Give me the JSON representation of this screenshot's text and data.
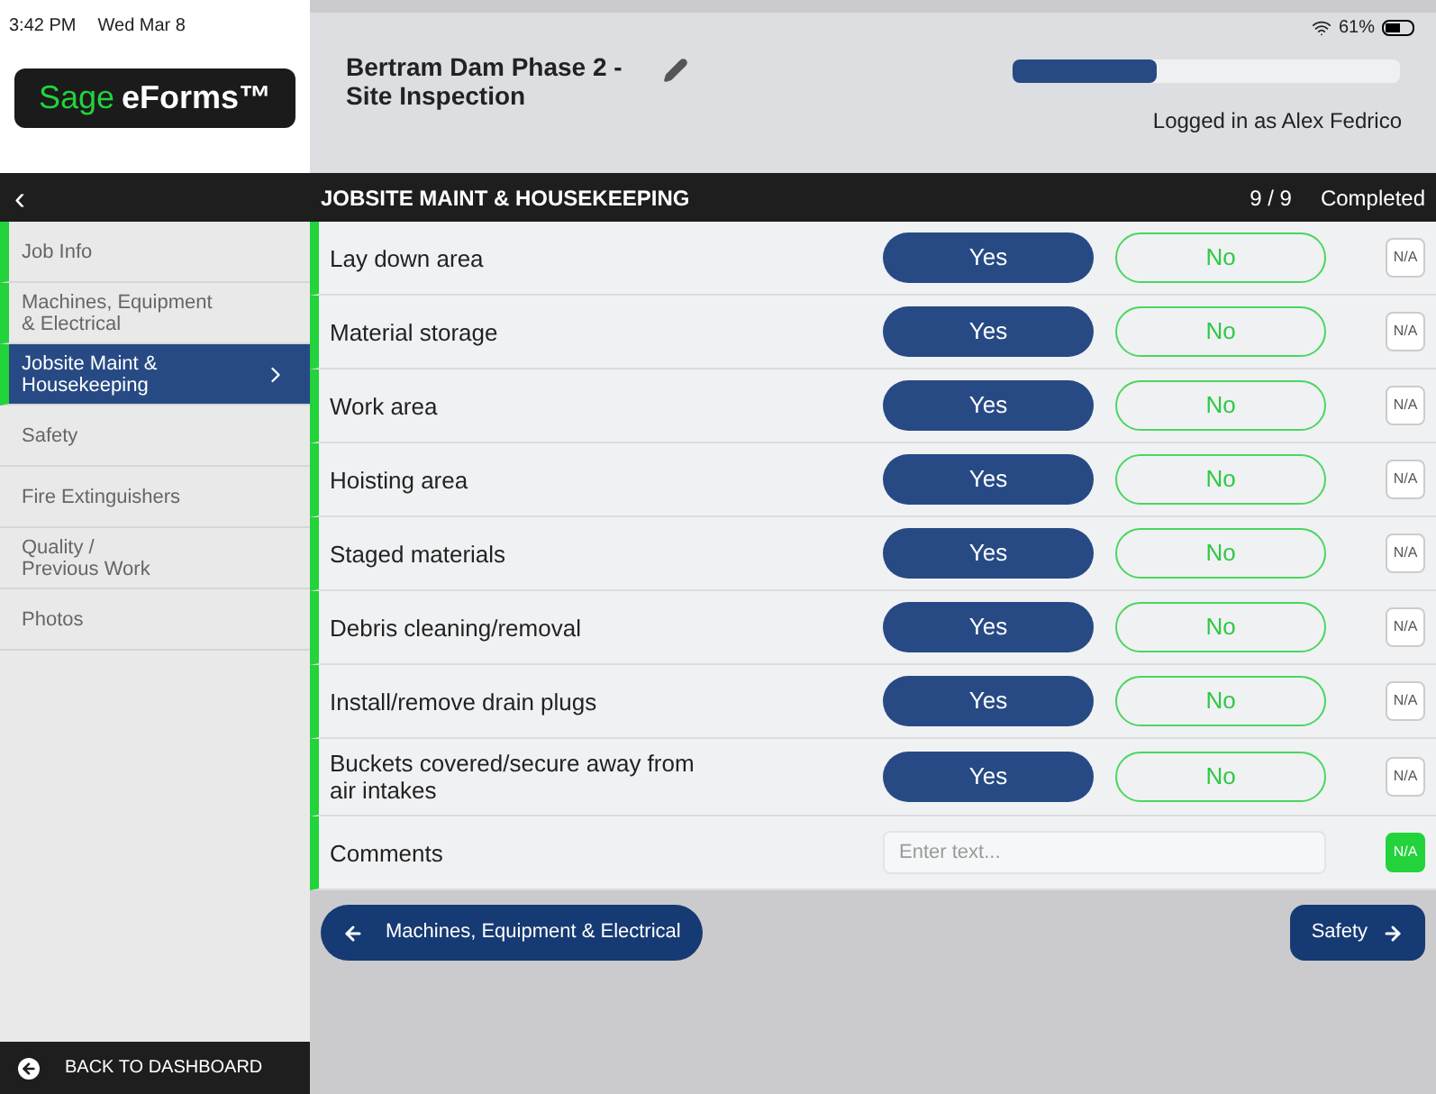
{
  "status_bar": {
    "time": "3:42 PM",
    "date": "Wed Mar 8",
    "battery": "61%"
  },
  "logo": {
    "brand": "Sage",
    "product": "eForms™"
  },
  "form_title": "Bertram Dam Phase 2 - Site Inspection",
  "progress": {
    "level": 0.37
  },
  "user": "Logged in as Alex Fedrico",
  "section_bar": {
    "back": "‹",
    "title": "JOBSITE MAINT & HOUSEKEEPING",
    "count": "9 / 9",
    "status": "Completed"
  },
  "sidebar": {
    "items": [
      {
        "label": "Job Info",
        "completed": true,
        "selected": false
      },
      {
        "label": "Machines, Equipment\n& Electrical",
        "completed": true,
        "selected": false
      },
      {
        "label": "Jobsite Maint &\nHousekeeping",
        "completed": true,
        "selected": true
      },
      {
        "label": "Safety",
        "completed": false,
        "selected": false
      },
      {
        "label": "Fire Extinguishers",
        "completed": false,
        "selected": false
      },
      {
        "label": "Quality /\nPrevious Work",
        "completed": false,
        "selected": false
      },
      {
        "label": "Photos",
        "completed": false,
        "selected": false
      }
    ],
    "back_to_dashboard": "BACK TO DASHBOARD"
  },
  "questions": [
    {
      "kind": "yesno",
      "label": "Lay down area",
      "yes": "Yes",
      "no": "No",
      "yes_selected": true,
      "no_selected": false,
      "na": "N/A",
      "na_selected": false,
      "completed": true
    },
    {
      "kind": "yesno",
      "label": "Material storage",
      "yes": "Yes",
      "no": "No",
      "yes_selected": true,
      "no_selected": false,
      "na": "N/A",
      "na_selected": false,
      "completed": true
    },
    {
      "kind": "yesno",
      "label": "Work area",
      "yes": "Yes",
      "no": "No",
      "yes_selected": true,
      "no_selected": false,
      "na": "N/A",
      "na_selected": false,
      "completed": true
    },
    {
      "kind": "yesno",
      "label": "Hoisting area",
      "yes": "Yes",
      "no": "No",
      "yes_selected": true,
      "no_selected": false,
      "na": "N/A",
      "na_selected": false,
      "completed": true
    },
    {
      "kind": "yesno",
      "label": "Staged materials",
      "yes": "Yes",
      "no": "No",
      "yes_selected": true,
      "no_selected": false,
      "na": "N/A",
      "na_selected": false,
      "completed": true
    },
    {
      "kind": "yesno",
      "label": "Debris cleaning/removal",
      "yes": "Yes",
      "no": "No",
      "yes_selected": true,
      "no_selected": false,
      "na": "N/A",
      "na_selected": false,
      "completed": true
    },
    {
      "kind": "yesno",
      "label": "Install/remove drain plugs",
      "yes": "Yes",
      "no": "No",
      "yes_selected": true,
      "no_selected": false,
      "na": "N/A",
      "na_selected": false,
      "completed": true
    },
    {
      "kind": "yesno",
      "label": "Buckets covered/secure away from air intakes",
      "yes": "Yes",
      "no": "No",
      "yes_selected": true,
      "no_selected": false,
      "na": "N/A",
      "na_selected": false,
      "completed": true
    },
    {
      "kind": "text",
      "label": "Comments",
      "placeholder": "Enter text...",
      "na": "N/A",
      "na_selected": true,
      "completed": true
    }
  ],
  "footer": {
    "prev": "Machines, Equipment & Electrical",
    "next": "Safety"
  }
}
